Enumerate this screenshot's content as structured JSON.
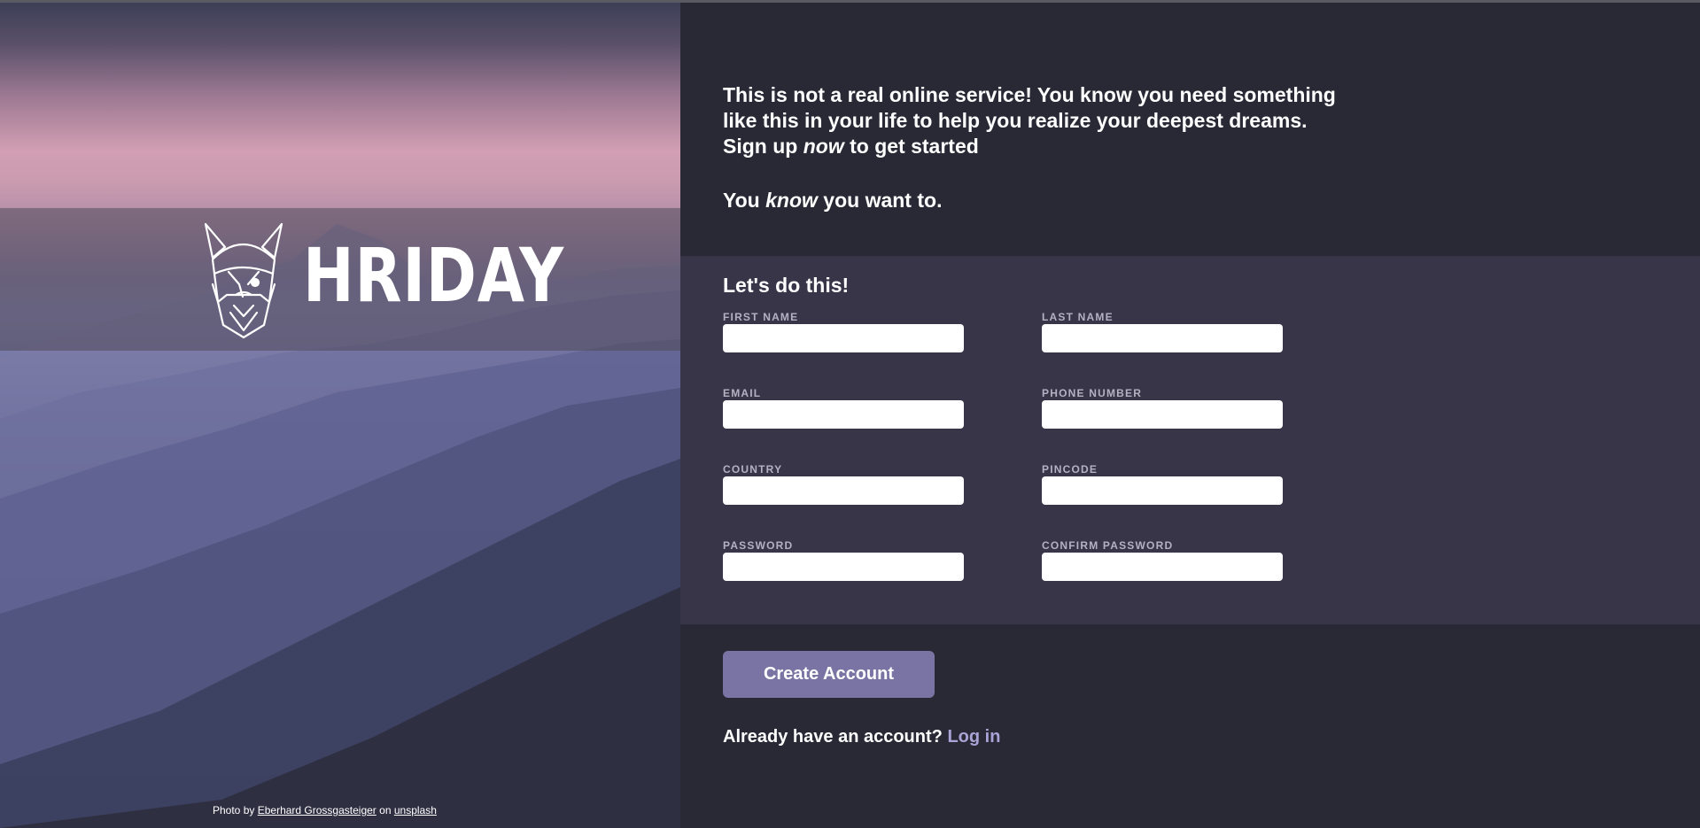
{
  "brand": {
    "name": "HRIDAY",
    "logo_icon": "viking-head-icon"
  },
  "photo_credit": {
    "prefix": "Photo by",
    "author": "Eberhard Grossgasteiger",
    "middle": "on",
    "source": "unsplash"
  },
  "intro": {
    "line1": "This is not a real online service! You know you need something like this in your life to help you realize your deepest dreams.",
    "line2_before": "Sign up ",
    "line2_em": "now",
    "line2_after": " to get started",
    "line3_before": "You ",
    "line3_em": "know",
    "line3_after": " you want to."
  },
  "form": {
    "title": "Let's do this!",
    "fields": [
      {
        "label": "FIRST NAME",
        "value": ""
      },
      {
        "label": "LAST NAME",
        "value": ""
      },
      {
        "label": "EMAIL",
        "value": ""
      },
      {
        "label": "PHONE NUMBER",
        "value": ""
      },
      {
        "label": "COUNTRY",
        "value": ""
      },
      {
        "label": "PINCODE",
        "value": ""
      },
      {
        "label": "PASSWORD",
        "value": ""
      },
      {
        "label": "CONFIRM PASSWORD",
        "value": ""
      }
    ]
  },
  "actions": {
    "create_label": "Create Account",
    "login_prompt": "Already have an account?",
    "login_link": "Log in"
  },
  "colors": {
    "left_panel_bg": "#292936",
    "form_bg": "#383549",
    "button_bg": "#7a74a4",
    "link": "#a9a4d6",
    "label": "#b4b1c2"
  }
}
